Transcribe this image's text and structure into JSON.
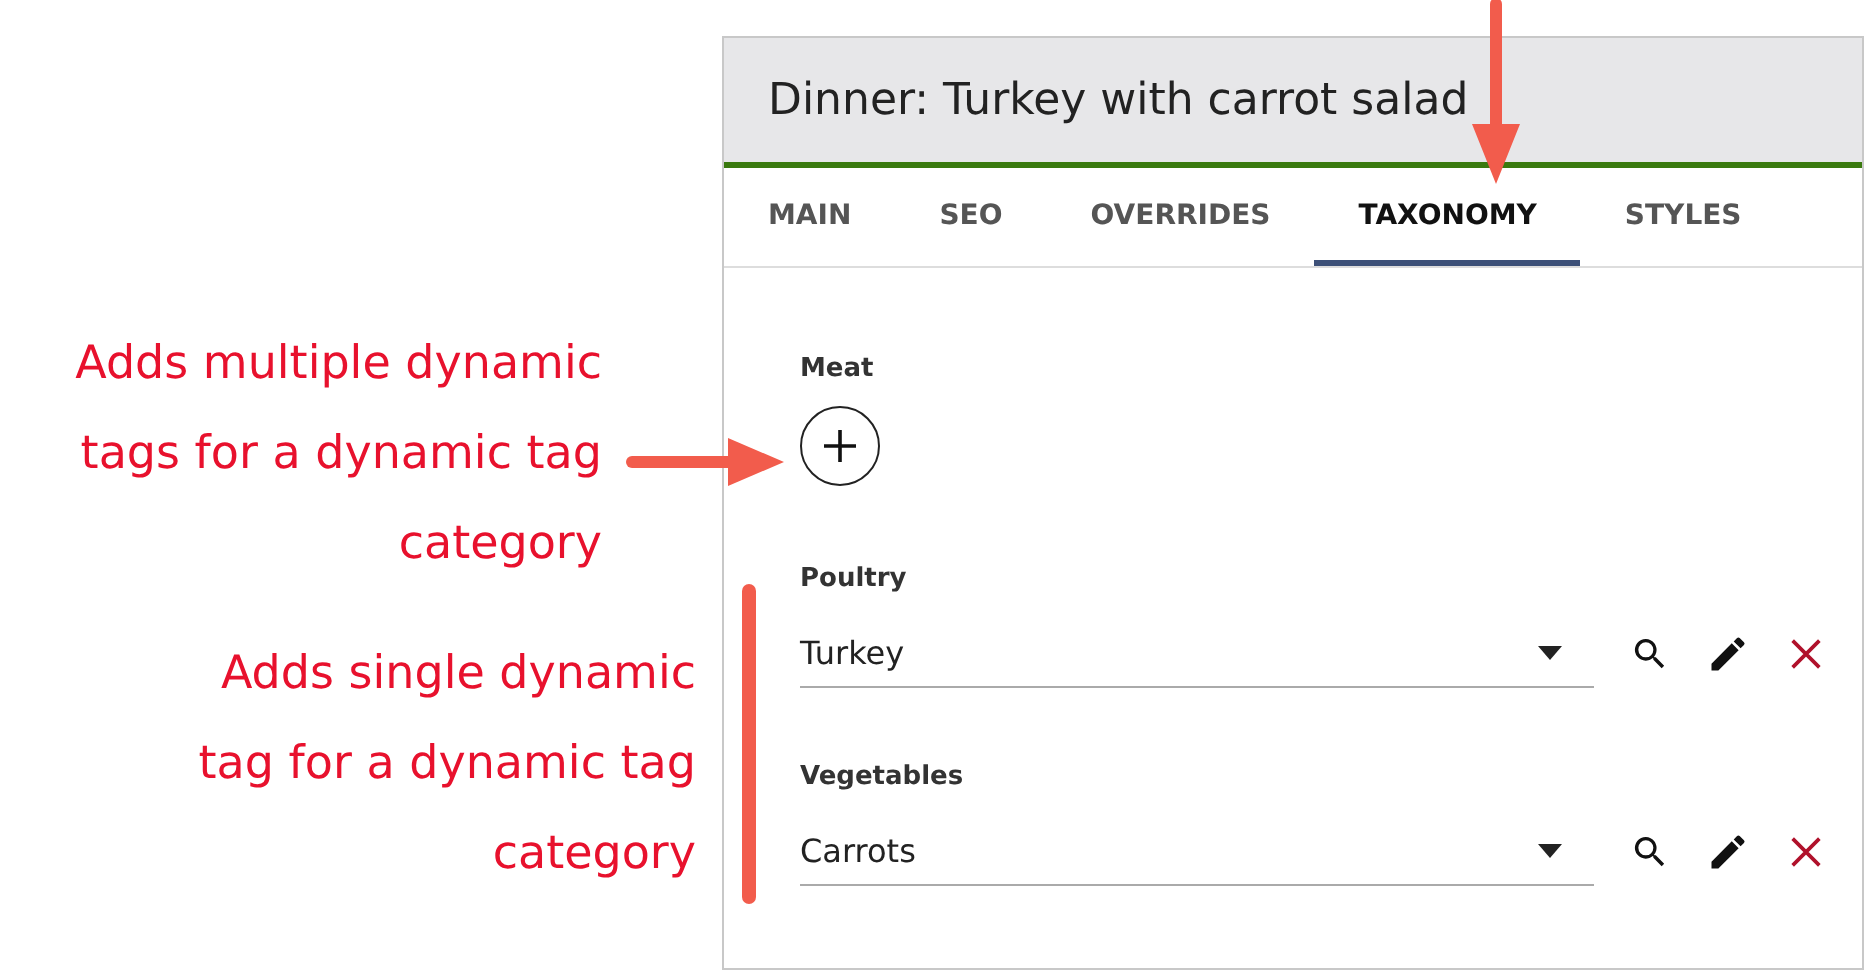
{
  "annotations": [
    {
      "text": "Adds multiple dynamic tags for a dynamic tag category"
    },
    {
      "text": "Adds single dynamic tag for a dynamic tag category"
    }
  ],
  "window": {
    "title": "Dinner: Turkey with carrot salad"
  },
  "tabs": [
    {
      "label": "MAIN",
      "selected": false
    },
    {
      "label": "SEO",
      "selected": false
    },
    {
      "label": "OVERRIDES",
      "selected": false
    },
    {
      "label": "TAXONOMY",
      "selected": true
    },
    {
      "label": "STYLES",
      "selected": false
    }
  ],
  "categories": [
    {
      "kind": "multiple",
      "label": "Meat"
    },
    {
      "kind": "single",
      "label": "Poultry",
      "value": "Turkey"
    },
    {
      "kind": "single",
      "label": "Vegetables",
      "value": "Carrots"
    }
  ]
}
